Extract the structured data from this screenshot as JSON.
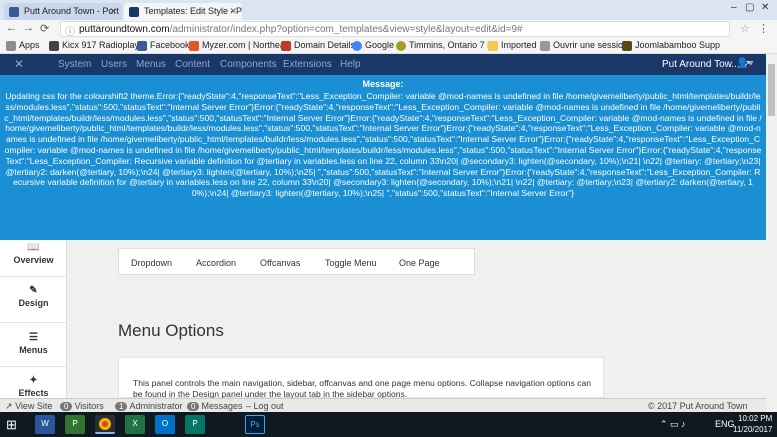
{
  "browser": {
    "tabs": [
      {
        "title": "Putt Around Town - Port",
        "active": false
      },
      {
        "title": "Templates: Edit Style - P",
        "active": true
      }
    ],
    "url_host": "puttaroundtown.com",
    "url_path": "/administrator/index.php?option=com_templates&view=style&layout=edit&id=9#",
    "bookmarks": [
      "Apps",
      "Kicx 917 Radioplayer",
      "Facebook",
      "Myzer.com | Northea",
      "Domain Details",
      "Google",
      "Timmins, Ontario 7 D",
      "Imported",
      "Ouvrir une session",
      "Joomlabamboo Supp"
    ]
  },
  "admin_nav": {
    "items": [
      "System",
      "Users",
      "Menus",
      "Content",
      "Components",
      "Extensions",
      "Help"
    ],
    "site_name": "Put Around Tow...",
    "site_link_icon": "external-link-icon",
    "user_icon": "user-icon"
  },
  "message": {
    "title": "Message:",
    "body": "Updating css for the colourshift2 theme.Error:{\"readyState\":4,\"responseText\":\"Less_Exception_Compiler: variable @mod-names is undefined in file /home/givemeliberty/public_html/templates/buildr/less/modules.less\",\"status\":500,\"statusText\":\"Internal Server Error\"}Error:{\"readyState\":4,\"responseText\":\"Less_Exception_Compiler: variable @mod-names is undefined in file /home/givemeliberty/public_html/templates/buildr/less/modules.less\",\"status\":500,\"statusText\":\"Internal Server Error\"}Error:{\"readyState\":4,\"responseText\":\"Less_Exception_Compiler: variable @mod-names is undefined in file /home/givemeliberty/public_html/templates/buildr/less/modules.less\",\"status\":500,\"statusText\":\"Internal Server Error\"}Error:{\"readyState\":4,\"responseText\":\"Less_Exception_Compiler: variable @mod-names is undefined in file /home/givemeliberty/public_html/templates/buildr/less/modules.less\",\"status\":500,\"statusText\":\"Internal Server Error\"}Error:{\"readyState\":4,\"responseText\":\"Less_Exception_Compiler: variable @mod-names is undefined in file /home/givemeliberty/public_html/templates/buildr/less/modules.less\",\"status\":500,\"statusText\":\"Internal Server Error\"}Error:{\"readyState\":4,\"responseText\":\"Less_Exception_Compiler: Recursive variable definition for @tertiary in variables.less on line 22, column 33\\n20| @secondary3: lighten(@secondary, 10%);\\n21| \\n22| @tertiary: @tertiary;\\n23| @tertiary2: darken(@tertiary, 10%);\\n24| @tertiary3: lighten(@tertiary, 10%);\\n25| \",\"status\":500,\"statusText\":\"Internal Server Error\"}Error:{\"readyState\":4,\"responseText\":\"Less_Exception_Compiler: Recursive variable definition for @tertiary in variables.less on line 22, column 33\\n20| @secondary3: lighten(@secondary, 10%);\\n21| \\n22| @tertiary: @tertiary;\\n23| @tertiary2: darken(@tertiary, 10%);\\n24| @tertiary3: lighten(@tertiary, 10%);\\n25| \",\"status\":500,\"statusText\":\"Internal Server Error\"}"
  },
  "sidebar": {
    "items": [
      {
        "label": "Overview",
        "icon": "book-icon"
      },
      {
        "label": "Design",
        "icon": "brush-icon"
      },
      {
        "label": "Menus",
        "icon": "menu-icon"
      },
      {
        "label": "Effects",
        "icon": "sparkle-icon"
      }
    ]
  },
  "subtabs": [
    "Dropdown",
    "Accordion",
    "Offcanvas",
    "Toggle Menu",
    "One Page"
  ],
  "main": {
    "heading": "Menu Options",
    "panel_text": "This panel controls the main navigation, sidebar, offcanvas and one page menu options. Collapse navigation options can be found in the Design panel under the layout tab in the sidebar options."
  },
  "statusbar": {
    "view_site": "View Site",
    "visitors_count": "0",
    "visitors_label": "Visitors",
    "admin_count": "1",
    "admin_label": "Administrator",
    "messages_count": "0",
    "messages_label": "Messages",
    "logout": "Log out",
    "copyright": "© 2017 Put Around Town"
  },
  "taskbar": {
    "apps": [
      "word-icon",
      "project-icon",
      "chrome-icon",
      "excel-icon",
      "outlook-icon",
      "publisher-icon",
      "photoshop-icon"
    ],
    "lang": "ENG",
    "time": "10:02 PM",
    "date": "11/20/2017"
  },
  "colors": {
    "admin_nav": "#1a3867",
    "message_bg": "#1b8fd3",
    "taskbar": "#101820"
  }
}
